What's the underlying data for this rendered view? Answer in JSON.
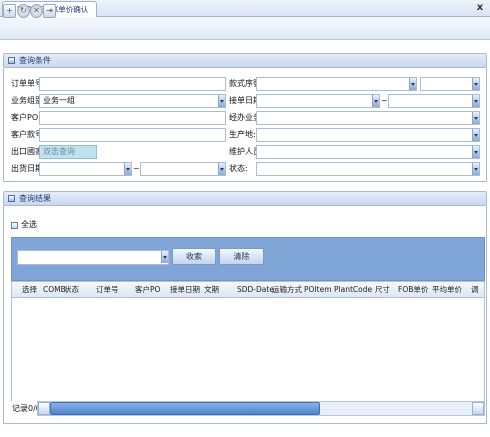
{
  "window": {
    "tab_title": "[OD007]FX单价确认",
    "close_glyph": "x"
  },
  "toolbar": {
    "buttons": [
      {
        "name": "new",
        "glyph": "+"
      },
      {
        "name": "refresh",
        "glyph": "↻"
      },
      {
        "name": "cancel",
        "glyph": "✕"
      },
      {
        "name": "export",
        "glyph": "⇥"
      }
    ]
  },
  "query_panel": {
    "title": "查询条件",
    "fields": {
      "order_no": {
        "label": "订单单号:",
        "value": ""
      },
      "style_no": {
        "label": "款式序號:",
        "value": ""
      },
      "biz_group": {
        "label": "业务组别:",
        "value": "业务一组"
      },
      "order_date": {
        "label": "接单日期:",
        "value": ""
      },
      "customer_po": {
        "label": "客户PO:",
        "value": ""
      },
      "handler": {
        "label": "经办业务:",
        "value": ""
      },
      "customer_style": {
        "label": "客户款号:",
        "value": ""
      },
      "factory": {
        "label": "生产地:",
        "value": ""
      },
      "export_country": {
        "label": "出口國家:",
        "value": "",
        "placeholder": "双击查询"
      },
      "maintainer": {
        "label": "维护人员:",
        "value": ""
      },
      "ship_date": {
        "label": "出货日期:",
        "value": ""
      },
      "status": {
        "label": "状态:",
        "value": ""
      }
    },
    "range_separator": "~"
  },
  "results_panel": {
    "title": "查询结果",
    "select_all": "全选",
    "filter_value": "",
    "collect_button": "收索",
    "clear_button": "清除",
    "columns": [
      "选择",
      "COMB",
      "状态",
      "订单号",
      "客户PO",
      "接单日期",
      "文期",
      "SDD-Date",
      "运输方式",
      "POItem",
      "PlantCode",
      "尺寸",
      "FOB单价",
      "平均单价",
      "调"
    ],
    "record_count": "记录0/0"
  }
}
